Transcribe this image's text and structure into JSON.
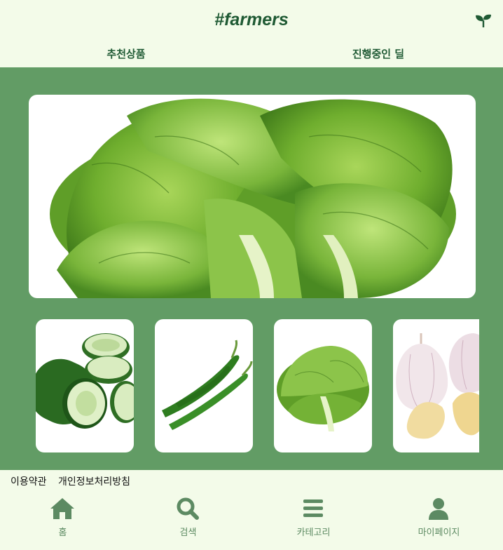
{
  "header": {
    "logo": "#farmers",
    "icon": "sprout-icon"
  },
  "tabs": [
    {
      "label": "추천상품"
    },
    {
      "label": "진행중인 딜"
    }
  ],
  "hero": {
    "image": "napa-cabbage"
  },
  "thumbnails": [
    {
      "image": "cucumber"
    },
    {
      "image": "green-chili-pepper"
    },
    {
      "image": "napa-cabbage"
    },
    {
      "image": "garlic"
    }
  ],
  "footer": {
    "terms": "이용약관",
    "privacy": "개인정보처리방침"
  },
  "bottom_nav": [
    {
      "label": "홈",
      "icon": "home-icon"
    },
    {
      "label": "검색",
      "icon": "search-icon"
    },
    {
      "label": "카테고리",
      "icon": "menu-icon"
    },
    {
      "label": "마이페이지",
      "icon": "user-icon"
    }
  ],
  "colors": {
    "brand": "#1f5a34",
    "panel": "#629c65",
    "background": "#f3fbe9",
    "nav": "#5c8a62"
  }
}
